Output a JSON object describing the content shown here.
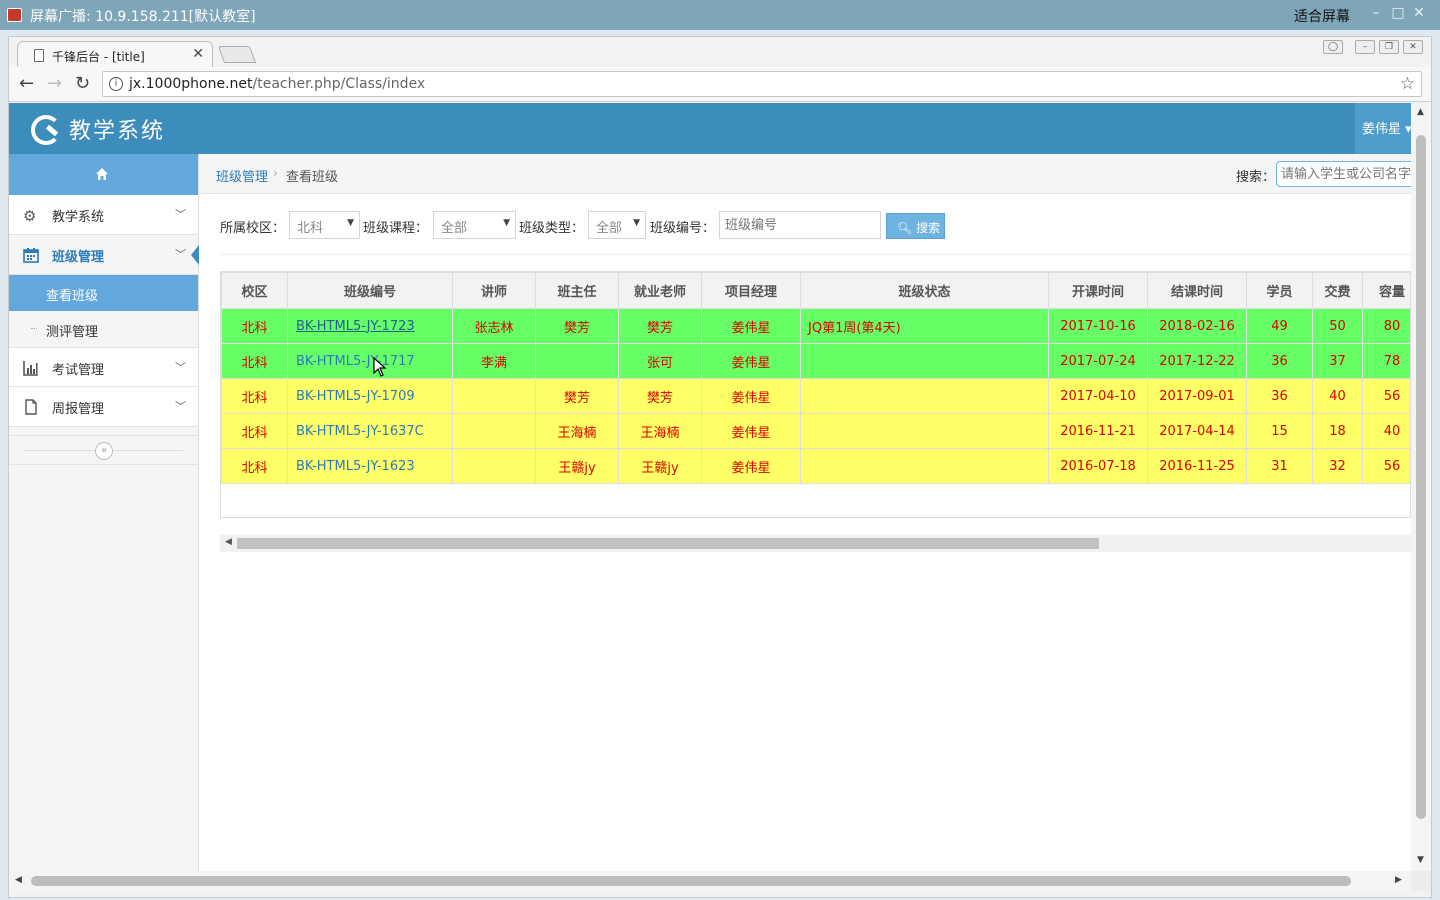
{
  "outer_window": {
    "title": "屏幕广播: 10.9.158.211[默认教室]",
    "fit_label": "适合屏幕",
    "controls": [
      "–",
      "□",
      "✕"
    ]
  },
  "browser": {
    "tab_title": "千锋后台 - [title]",
    "url_host": "jx.1000phone.net",
    "url_path": "/teacher.php/Class/index"
  },
  "app": {
    "logo_text": "教学系统",
    "user": "姜伟星 ▾",
    "brand_color": "#3c8dbc"
  },
  "sidebar": {
    "items": [
      {
        "label": "教学系统",
        "icon": "gear-icon"
      },
      {
        "label": "班级管理",
        "icon": "calendar-icon"
      },
      {
        "label": "考试管理",
        "icon": "bar-chart-icon"
      },
      {
        "label": "周报管理",
        "icon": "file-icon"
      }
    ],
    "sub_items": [
      {
        "label": "查看班级"
      },
      {
        "label": "测评管理"
      }
    ]
  },
  "breadcrumb": {
    "parent": "班级管理",
    "current": "查看班级",
    "search_label": "搜索：",
    "search_placeholder": "请输入学生或公司名字"
  },
  "filters": {
    "campus_label": "所属校区：",
    "campus_value": "北科",
    "course_label": "班级课程：",
    "course_value": "全部",
    "type_label": "班级类型：",
    "type_value": "全部",
    "code_label": "班级编号：",
    "code_placeholder": "班级编号",
    "search_button": "搜索"
  },
  "table": {
    "headers": [
      "校区",
      "班级编号",
      "讲师",
      "班主任",
      "就业老师",
      "项目经理",
      "班级状态",
      "开课时间",
      "结课时间",
      "学员",
      "交费",
      "容量"
    ],
    "rows": [
      {
        "campus": "北科",
        "code": "BK-HTML5-JY-1723",
        "teacher": "张志林",
        "head": "樊芳",
        "job": "樊芳",
        "pm": "姜伟星",
        "status": "JQ第1周(第4天)",
        "start": "2017-10-16",
        "end": "2018-02-16",
        "students": "49",
        "paid": "50",
        "capacity": "80",
        "color": "green"
      },
      {
        "campus": "北科",
        "code": "BK-HTML5-JY-1717",
        "teacher": "李满",
        "head": "",
        "job": "张可",
        "pm": "姜伟星",
        "status": "",
        "start": "2017-07-24",
        "end": "2017-12-22",
        "students": "36",
        "paid": "37",
        "capacity": "78",
        "color": "green"
      },
      {
        "campus": "北科",
        "code": "BK-HTML5-JY-1709",
        "teacher": "",
        "head": "樊芳",
        "job": "樊芳",
        "pm": "姜伟星",
        "status": "",
        "start": "2017-04-10",
        "end": "2017-09-01",
        "students": "36",
        "paid": "40",
        "capacity": "56",
        "color": "yellow"
      },
      {
        "campus": "北科",
        "code": "BK-HTML5-JY-1637C",
        "teacher": "",
        "head": "王海楠",
        "job": "王海楠",
        "pm": "姜伟星",
        "status": "",
        "start": "2016-11-21",
        "end": "2017-04-14",
        "students": "15",
        "paid": "18",
        "capacity": "40",
        "color": "yellow"
      },
      {
        "campus": "北科",
        "code": "BK-HTML5-JY-1623",
        "teacher": "",
        "head": "王赣jy",
        "job": "王赣jy",
        "pm": "姜伟星",
        "status": "",
        "start": "2016-07-18",
        "end": "2016-11-25",
        "students": "31",
        "paid": "32",
        "capacity": "56",
        "color": "yellow"
      }
    ]
  }
}
